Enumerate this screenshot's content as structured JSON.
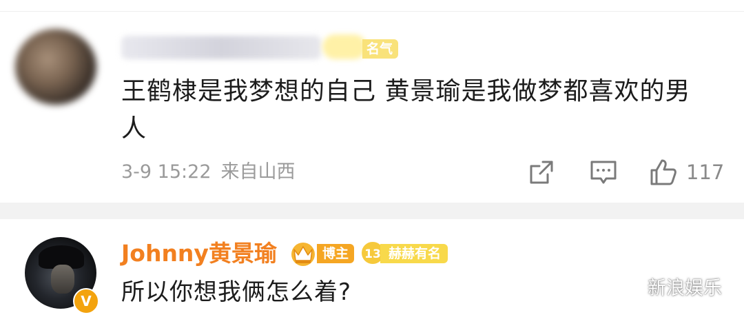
{
  "comment1": {
    "user_badge": "名气",
    "text": "王鹤棣是我梦想的自己 黄景瑜是我做梦都喜欢的男人",
    "date": "3-9 15:22",
    "location": "来自山西",
    "like_count": "117"
  },
  "comment2": {
    "username": "Johnny黄景瑜",
    "badge_bozhu": "博主",
    "level": "13",
    "badge_hehe": "赫赫有名",
    "verified_mark": "V",
    "text": "所以你想我俩怎么着?"
  },
  "watermark": {
    "label": "新浪娱乐"
  },
  "icons": [
    "share-icon",
    "comment-icon",
    "like-icon",
    "crown-icon",
    "level-icon",
    "wechat-icon"
  ],
  "colors": {
    "username": "#f28020",
    "badge_orange": "#f5a623",
    "badge_yellow": "#f8d94b",
    "meta_gray": "#9a9a9a",
    "divider": "#f2f2f2"
  }
}
